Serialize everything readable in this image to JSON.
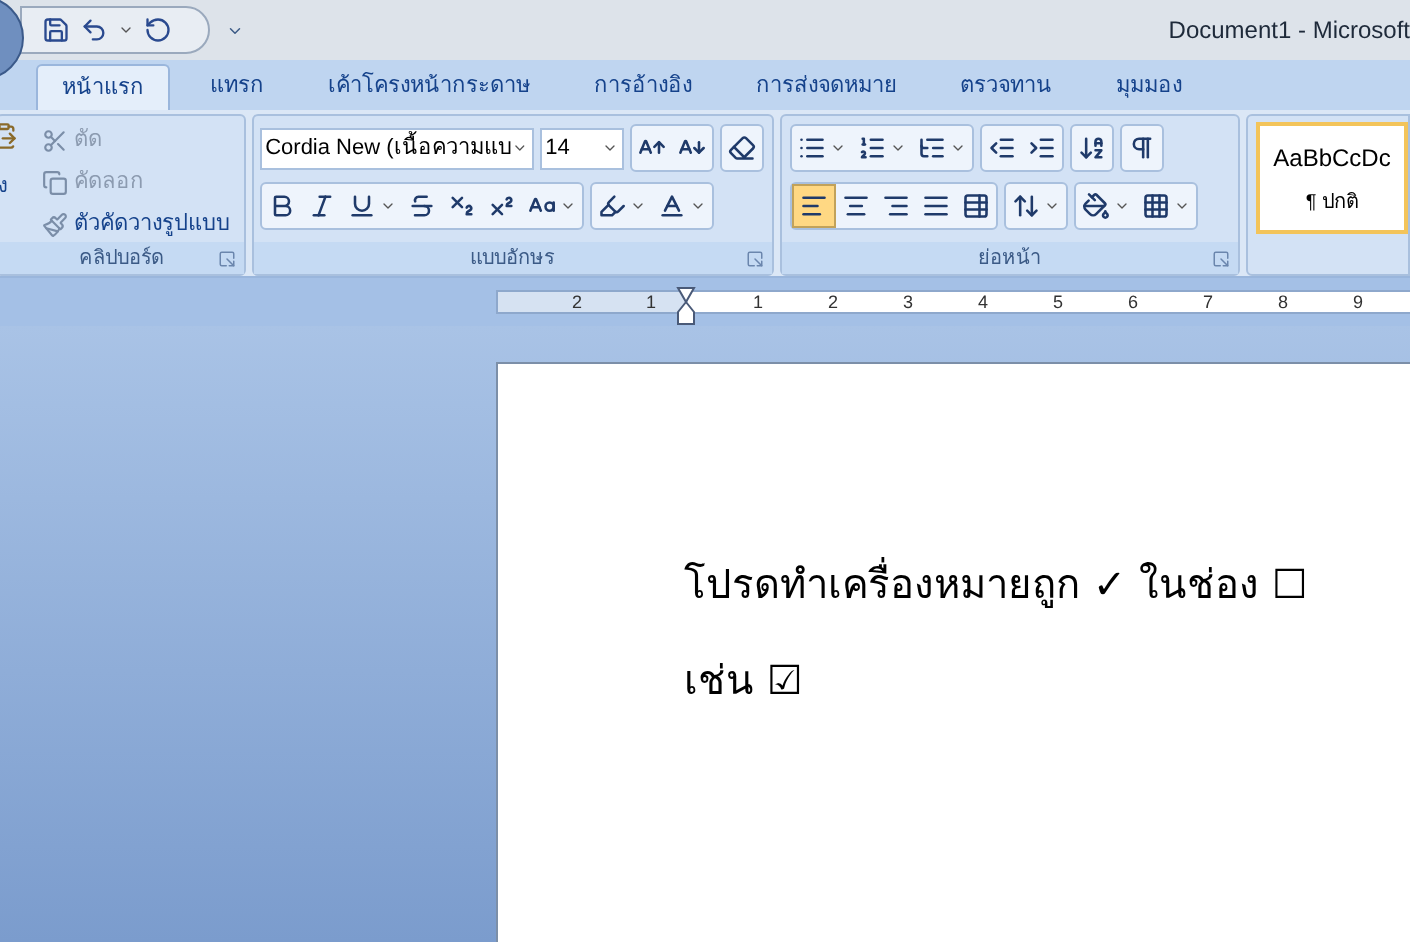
{
  "window": {
    "title": "Document1 - Microsoft"
  },
  "tabs": [
    {
      "label": "หน้าแรก",
      "selected": true
    },
    {
      "label": "แทรก",
      "selected": false
    },
    {
      "label": "เค้าโครงหน้ากระดาษ",
      "selected": false
    },
    {
      "label": "การอ้างอิง",
      "selected": false
    },
    {
      "label": "การส่งจดหมาย",
      "selected": false
    },
    {
      "label": "ตรวจทาน",
      "selected": false
    },
    {
      "label": "มุมมอง",
      "selected": false
    }
  ],
  "clipboard": {
    "paste_label": "ง",
    "cut": "ตัด",
    "copy": "คัดลอก",
    "format_painter": "ตัวคัดวางรูปแบบ",
    "group_label": "คลิปบอร์ด"
  },
  "font": {
    "name": "Cordia New (เนื้อความแบ",
    "size": "14",
    "group_label": "แบบอักษร"
  },
  "paragraph": {
    "alignments": [
      {
        "kind": "left",
        "selected": true
      },
      {
        "kind": "center",
        "selected": false
      },
      {
        "kind": "right",
        "selected": false
      },
      {
        "kind": "justify",
        "selected": false
      }
    ],
    "group_label": "ย่อหน้า"
  },
  "styles": {
    "preview": "AaBbCcDc",
    "name": "¶ ปกติ"
  },
  "ruler": {
    "left_labels": [
      "2",
      "1"
    ],
    "right_labels": [
      "1",
      "2",
      "3",
      "4",
      "5",
      "6",
      "7",
      "8",
      "9"
    ]
  },
  "document": {
    "lines": [
      "โปรดทำเครื่องหมายถูก ✓ ในช่อง ☐",
      "เช่น ☑"
    ]
  }
}
